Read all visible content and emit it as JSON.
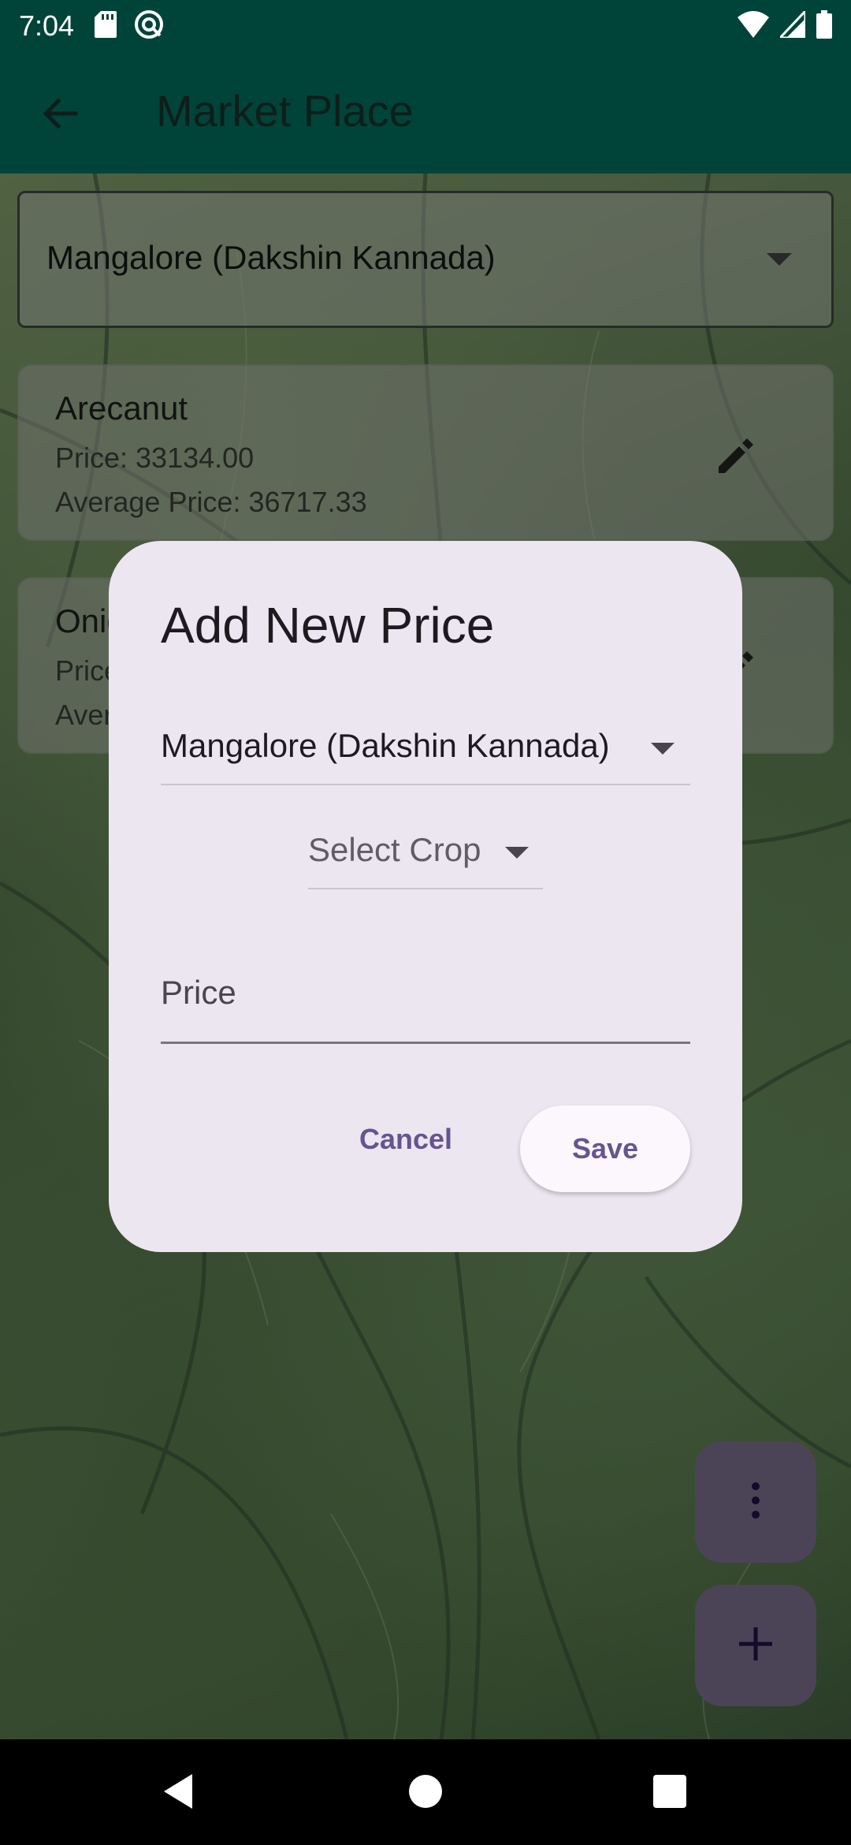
{
  "status_bar": {
    "time": "7:04",
    "icons": [
      "sd-card-icon",
      "vpn-icon",
      "wifi-icon",
      "signal-icon",
      "battery-icon"
    ]
  },
  "app_bar": {
    "title": "Market Place",
    "back_icon": "arrow-left-icon"
  },
  "location_dropdown": {
    "selected": "Mangalore (Dakshin Kannada)"
  },
  "crops": [
    {
      "name": "Arecanut",
      "price": "Price: 33134.00",
      "average_price": "Average Price: 36717.33"
    },
    {
      "name": "Onion",
      "price": "Price",
      "average_price": "Average Price"
    }
  ],
  "dialog": {
    "title": "Add New Price",
    "location_value": "Mangalore (Dakshin Kannada)",
    "crop_placeholder": "Select Crop",
    "price_placeholder": "Price",
    "cancel_label": "Cancel",
    "save_label": "Save"
  },
  "fabs": {
    "more_icon": "more-vertical-icon",
    "add_icon": "plus-icon"
  },
  "colors": {
    "app_bar": "#004439",
    "dialog_bg": "#ece6f0",
    "accent": "#65558f",
    "fab_bg": "#6f6580"
  }
}
